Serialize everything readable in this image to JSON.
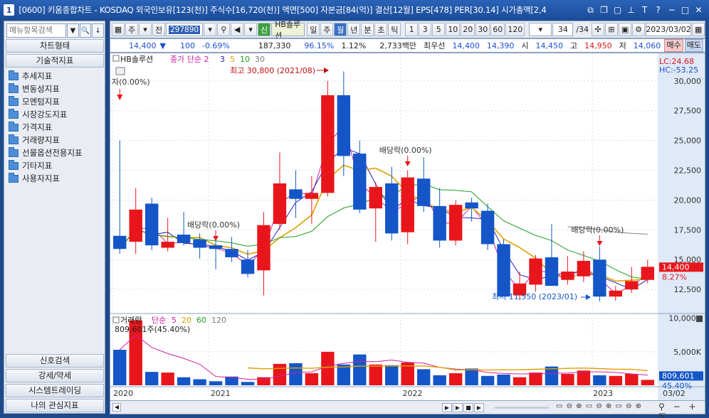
{
  "window": {
    "title": "[0600] 키움종합차트 - KOSDAQ 외국인보유[123(천)] 주식수[16,720(천)] 액면[500] 자본금[84(억)] 결산[12월] EPS[478] PER[30.14] 시가총액[2,4",
    "app_number": "1"
  },
  "left": {
    "search_placeholder": "메뉴항목검색",
    "header_chart_type": "차트형태",
    "header_indicators": "기술적지표",
    "folders": [
      "추세지표",
      "변동성지표",
      "모멘텀지표",
      "시장강도지표",
      "가격지표",
      "거래량지표",
      "선물옵션전용지표",
      "기타지표",
      "사용자지표"
    ],
    "bottom_items": [
      "신호검색",
      "강세/약세",
      "시스템트레이딩",
      "나의 관심지표"
    ]
  },
  "toolbar": {
    "period": "주",
    "prev": "전",
    "code": "297890",
    "credit": "신",
    "stock_name": "HB솔루션",
    "periods": [
      "일",
      "주",
      "월",
      "년",
      "분",
      "초",
      "틱"
    ],
    "active_period": "월",
    "numbers": [
      "1",
      "3",
      "5",
      "10",
      "20",
      "30",
      "60",
      "120"
    ],
    "count": "34",
    "count_total": "/34",
    "date": "2023/03/02"
  },
  "quote": {
    "price": "14,400",
    "down_arrow": "▼",
    "change": "100",
    "change_pct": "-0.69%",
    "volume": "187,330",
    "ratio": "96.15%",
    "turnover": "1.12%",
    "amount": "2,733백만",
    "best_label": "최우선",
    "ask": "14,400",
    "bid": "14,390",
    "open_label": "시",
    "open": "14,450",
    "high_label": "고",
    "high": "14,950",
    "low_label": "저",
    "low": "14,060",
    "buy": "매수",
    "sell": "매도"
  },
  "chart_data": [
    {
      "type": "candlestick",
      "title": "HB솔루션",
      "legend": [
        "종가 단순 2",
        "3",
        "5",
        "10",
        "30"
      ],
      "legend_colors": [
        "#d020a0",
        "#2020c0",
        "#e0a000",
        "#20a020",
        "#808080"
      ],
      "x_labels": [
        "2020",
        "2021",
        "2022",
        "2023",
        "03/02"
      ],
      "y_ticks": [
        12500,
        15000,
        17500,
        20000,
        22500,
        25000,
        27500,
        30000
      ],
      "ylim": [
        10600,
        31600
      ],
      "candles": [
        {
          "o": 17000,
          "h": 25000,
          "l": 15500,
          "c": 15900
        },
        {
          "o": 16500,
          "h": 21000,
          "l": 15500,
          "c": 19200
        },
        {
          "o": 19700,
          "h": 20200,
          "l": 15800,
          "c": 16200
        },
        {
          "o": 16000,
          "h": 18500,
          "l": 15700,
          "c": 16500
        },
        {
          "o": 17100,
          "h": 19000,
          "l": 16200,
          "c": 16400
        },
        {
          "o": 16700,
          "h": 17200,
          "l": 15100,
          "c": 16000
        },
        {
          "o": 16200,
          "h": 17100,
          "l": 14200,
          "c": 15900
        },
        {
          "o": 15900,
          "h": 16900,
          "l": 14800,
          "c": 15200
        },
        {
          "o": 15000,
          "h": 15800,
          "l": 13500,
          "c": 13800
        },
        {
          "o": 14100,
          "h": 19000,
          "l": 12000,
          "c": 17900
        },
        {
          "o": 18000,
          "h": 24000,
          "l": 17500,
          "c": 21400
        },
        {
          "o": 20900,
          "h": 22500,
          "l": 18500,
          "c": 20100
        },
        {
          "o": 20100,
          "h": 22000,
          "l": 18000,
          "c": 20600
        },
        {
          "o": 20600,
          "h": 30000,
          "l": 20300,
          "c": 28800
        },
        {
          "o": 28800,
          "h": 30800,
          "l": 22000,
          "c": 23700
        },
        {
          "o": 23900,
          "h": 25000,
          "l": 18900,
          "c": 19200
        },
        {
          "o": 19300,
          "h": 21500,
          "l": 16500,
          "c": 21100
        },
        {
          "o": 21400,
          "h": 22800,
          "l": 16600,
          "c": 17200
        },
        {
          "o": 17300,
          "h": 22500,
          "l": 16300,
          "c": 21900
        },
        {
          "o": 21800,
          "h": 23600,
          "l": 19000,
          "c": 19500
        },
        {
          "o": 19500,
          "h": 21000,
          "l": 16000,
          "c": 16600
        },
        {
          "o": 16600,
          "h": 20000,
          "l": 16200,
          "c": 19600
        },
        {
          "o": 19800,
          "h": 20200,
          "l": 18200,
          "c": 19300
        },
        {
          "o": 19100,
          "h": 19700,
          "l": 15800,
          "c": 16300
        },
        {
          "o": 16300,
          "h": 16700,
          "l": 12200,
          "c": 11900
        },
        {
          "o": 12000,
          "h": 14000,
          "l": 11600,
          "c": 13000
        },
        {
          "o": 12900,
          "h": 15400,
          "l": 12300,
          "c": 15100
        },
        {
          "o": 15200,
          "h": 18000,
          "l": 12800,
          "c": 12800
        },
        {
          "o": 13300,
          "h": 15300,
          "l": 12900,
          "c": 14000
        },
        {
          "o": 13600,
          "h": 15700,
          "l": 13100,
          "c": 14900
        },
        {
          "o": 15000,
          "h": 16100,
          "l": 11500,
          "c": 11900
        },
        {
          "o": 11900,
          "h": 12800,
          "l": 11550,
          "c": 12400
        },
        {
          "o": 12500,
          "h": 14400,
          "l": 12200,
          "c": 13200
        },
        {
          "o": 13300,
          "h": 15000,
          "l": 13000,
          "c": 14400
        }
      ],
      "annotations": {
        "high_label": "최고 30,800 (2021/08)",
        "low_label": "최저 11,550 (2023/01)",
        "dividend": "배당락(0.00%)",
        "dividend_first": "자(0.00%)"
      },
      "lc": "LC:24.68",
      "hc": "HC:-53.25",
      "last_price": "14,400",
      "last_pct": "8.27%"
    },
    {
      "type": "bar",
      "title": "거래량",
      "legend": [
        "단순",
        "5",
        "20",
        "60",
        "120"
      ],
      "legend_colors": [
        "#d020a0",
        "#d020a0",
        "#e0a000",
        "#20a020",
        "#808080"
      ],
      "info": "809,601주(45.40%)",
      "y_ticks": [
        "10,000K",
        "5,000K"
      ],
      "ylim": [
        0,
        10500
      ],
      "values": [
        5300,
        9700,
        2000,
        1900,
        1200,
        900,
        600,
        1300,
        500,
        1200,
        3200,
        3300,
        1800,
        5000,
        3100,
        4600,
        3100,
        3000,
        3400,
        2400,
        1500,
        1800,
        2500,
        1400,
        1600,
        1200,
        1900,
        2800,
        1700,
        2200,
        1500,
        1400,
        1700,
        810
      ],
      "last_value": "809,601",
      "last_pct": "45.40%"
    }
  ]
}
